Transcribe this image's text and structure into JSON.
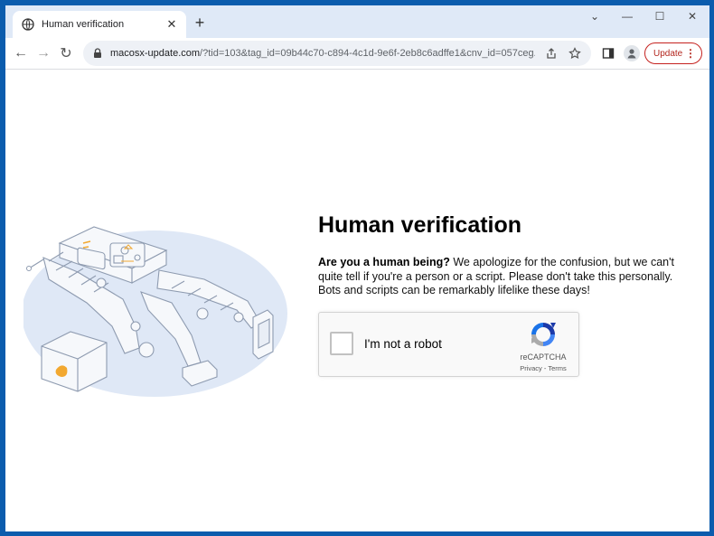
{
  "tab": {
    "title": "Human verification",
    "close_glyph": "✕"
  },
  "newtab_glyph": "+",
  "window_controls": {
    "dropdown": "⌄",
    "minimize": "—",
    "maximize": "☐",
    "close": "✕"
  },
  "toolbar": {
    "back": "←",
    "forward": "→",
    "reload": "↻",
    "url_host": "macosx-update.com",
    "url_rest": "/?tid=103&tag_id=09b44c70-c894-4c1d-9e6f-2eb8c6adffe1&cnv_id=057ceg...",
    "update_label": "Update",
    "menu_glyph": "⋮"
  },
  "page": {
    "heading": "Human verification",
    "intro_bold": "Are you a human being?",
    "intro_text": " We apologize for the confusion, but we can't quite tell if you're a person or a script. Please don't take this personally. Bots and scripts can be remarkably lifelike these days!"
  },
  "captcha": {
    "label": "I'm not a robot",
    "brand": "reCAPTCHA",
    "links": "Privacy - Terms"
  },
  "colors": {
    "accent_blue": "#1a73e8",
    "desktop": "#0b5cad",
    "update_red": "#c5221f"
  }
}
